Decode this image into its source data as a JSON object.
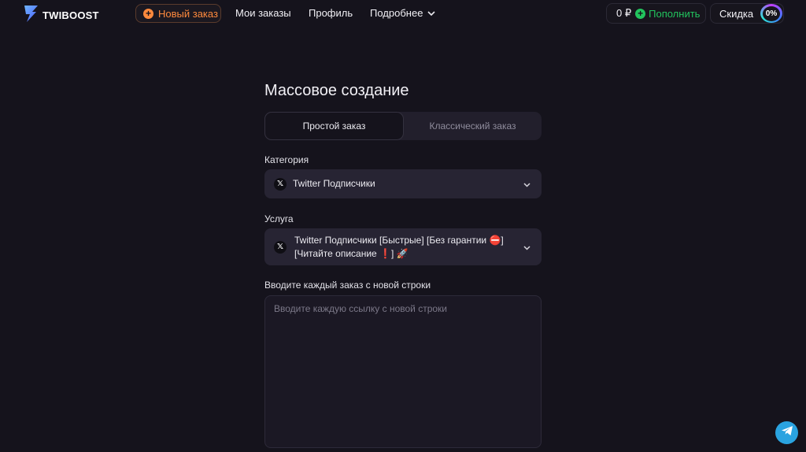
{
  "header": {
    "logo_text": "TWIBOOST",
    "new_order_label": "Новый заказ",
    "nav": {
      "my_orders": "Мои заказы",
      "profile": "Профиль",
      "more": "Подробнее"
    },
    "balance": {
      "amount": "0 ₽",
      "topup_label": "Пополнить"
    },
    "discount": {
      "label": "Скидка",
      "value": "0%"
    }
  },
  "main": {
    "title": "Массовое создание",
    "tabs": [
      {
        "label": "Простой заказ",
        "active": true
      },
      {
        "label": "Классический заказ",
        "active": false
      }
    ],
    "category": {
      "label": "Категория",
      "icon": "x-logo-icon",
      "value": "Twitter Подписчики"
    },
    "service": {
      "label": "Услуга",
      "icon": "x-logo-icon",
      "value_line1": "Twitter Подписчики [Быстрые] [Без гарантии ⛔]",
      "value_line2": "[Читайте описание ❗] 🚀"
    },
    "orders": {
      "label": "Вводите каждый заказ с новой строки",
      "value": "",
      "placeholder": "Вводите каждую ссылку с новой строки"
    }
  },
  "colors": {
    "background": "#15131c",
    "accent_orange": "#ff8a3d",
    "accent_green": "#22c55e",
    "telegram_blue": "#2aa3e0"
  }
}
